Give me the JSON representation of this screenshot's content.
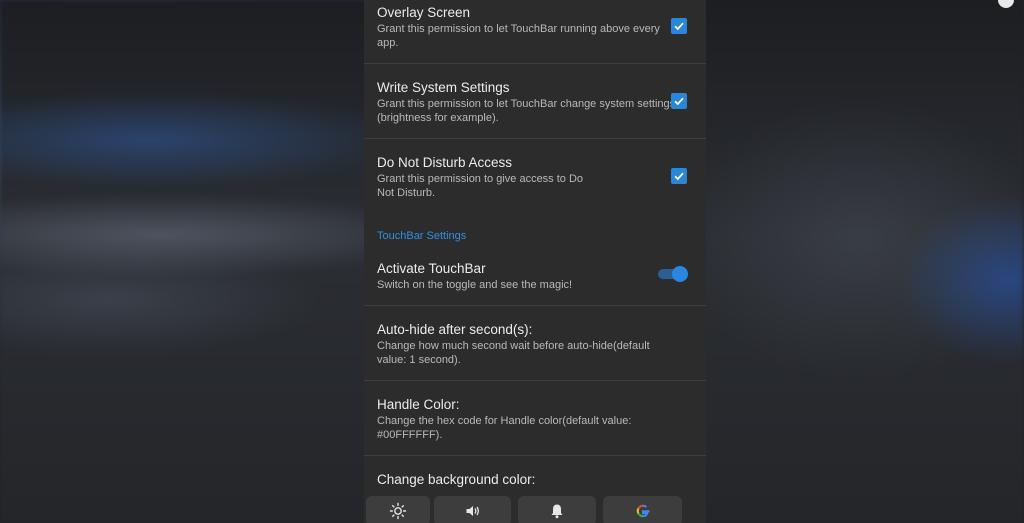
{
  "permissions": [
    {
      "title": "Overlay Screen",
      "desc": "Grant this permission to let TouchBar running above every app.",
      "checked": true
    },
    {
      "title": "Write System Settings",
      "desc": "Grant this permission to let TouchBar change system settings (brightness for example).",
      "checked": true
    },
    {
      "title": "Do Not Disturb Access",
      "desc": "Grant this permission to give access to Do Not Disturb.",
      "checked": true
    }
  ],
  "section": {
    "touchbar_settings": "TouchBar Settings"
  },
  "settings": [
    {
      "title": "Activate TouchBar",
      "desc": "Switch on the toggle and see the magic!",
      "toggle_on": true
    },
    {
      "title": "Auto-hide after second(s):",
      "desc": "Change how much second wait before auto-hide(default value: 1 second)."
    },
    {
      "title": "Handle Color:",
      "desc": "Change the hex code for Handle color(default value: #00FFFFFF)."
    },
    {
      "title": "Change background color:",
      "desc": ""
    }
  ],
  "quickbar": [
    {
      "icon": "brightness-icon"
    },
    {
      "icon": "volume-icon"
    },
    {
      "icon": "bell-icon"
    },
    {
      "icon": "google-icon"
    }
  ],
  "colors": {
    "accent": "#2a86d8",
    "panel": "#2c2c2c",
    "divider": "#3f3f3f"
  }
}
